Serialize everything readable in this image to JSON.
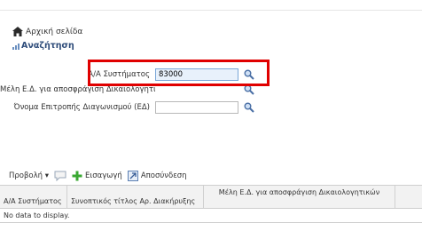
{
  "breadcrumb": {
    "home_label": "Αρχική σελίδα"
  },
  "section": {
    "title": "Αναζήτηση"
  },
  "form": {
    "system_id": {
      "label": "Α/Α Συστήματος",
      "value": "83000"
    },
    "committee_members": {
      "label": "Μέλη Ε.Δ. για αποσφράγιση Δικαιολογητικών",
      "value": ""
    },
    "committee_name": {
      "label": "Όνομα Επιτροπής Διαγωνισμού (ΕΔ)",
      "value": ""
    }
  },
  "toolbar": {
    "view_label": "Προβολή ▾",
    "import_label": "Εισαγωγή",
    "detach_label": "Αποσύνδεση"
  },
  "grid": {
    "columns": [
      "Α/Α Συστήματος",
      "Συνοπτικός τίτλος Αρ. Διακήρυξης",
      "Μέλη Ε.Δ. για αποσφράγιση Δικαιολογητικών"
    ],
    "empty_text": "No data to display."
  },
  "colors": {
    "highlight": "#e00000",
    "accent": "#2e4c7a"
  }
}
